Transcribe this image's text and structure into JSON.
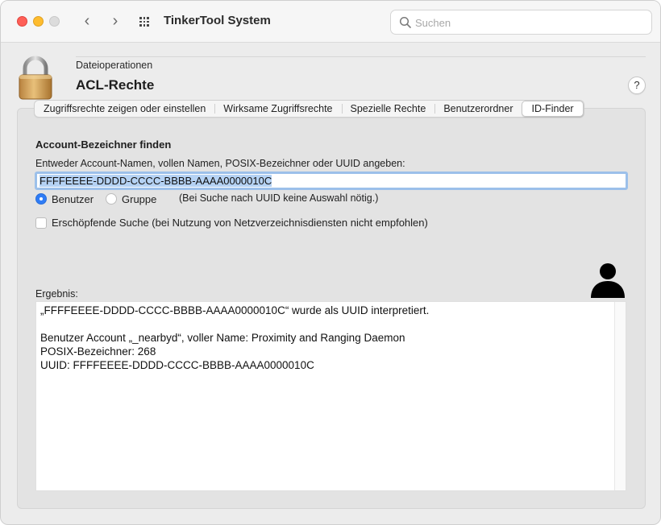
{
  "window": {
    "app_title": "TinkerTool System",
    "search": {
      "placeholder": "Suchen",
      "value": ""
    }
  },
  "header": {
    "category": "Dateioperationen",
    "title": "ACL-Rechte",
    "help_label": "?"
  },
  "tabs": [
    {
      "label": "Zugriffsrechte zeigen oder einstellen",
      "active": false
    },
    {
      "label": "Wirksame Zugriffsrechte",
      "active": false
    },
    {
      "label": "Spezielle Rechte",
      "active": false
    },
    {
      "label": "Benutzerordner",
      "active": false
    },
    {
      "label": "ID-Finder",
      "active": true
    }
  ],
  "finder": {
    "section_title": "Account-Bezeichner finden",
    "field_label": "Entweder Account-Namen, vollen Namen, POSIX-Bezeichner oder UUID angeben:",
    "field_value": "FFFFEEEE-DDDD-CCCC-BBBB-AAAA0000010C",
    "radio_user": "Benutzer",
    "radio_group": "Gruppe",
    "radio_selected": "Benutzer",
    "radio_hint": "(Bei Suche nach UUID keine Auswahl nötig.)",
    "exhaustive_label": "Erschöpfende Suche (bei Nutzung von Netzverzeichnisdiensten nicht empfohlen)",
    "exhaustive_checked": false
  },
  "result": {
    "label": "Ergebnis:",
    "lines": [
      "„FFFFEEEE-DDDD-CCCC-BBBB-AAAA0000010C“ wurde als UUID interpretiert.",
      "",
      "Benutzer Account „_nearbyd“, voller Name: Proximity and Ranging Daemon",
      "POSIX-Bezeichner: 268",
      "UUID: FFFFEEEE-DDDD-CCCC-BBBB-AAAA0000010C"
    ],
    "icon": "person-icon"
  },
  "colors": {
    "accent": "#2f7cf6",
    "selection": "#b5d2f4",
    "close": "#fe5f57",
    "minimize": "#febc2e"
  }
}
